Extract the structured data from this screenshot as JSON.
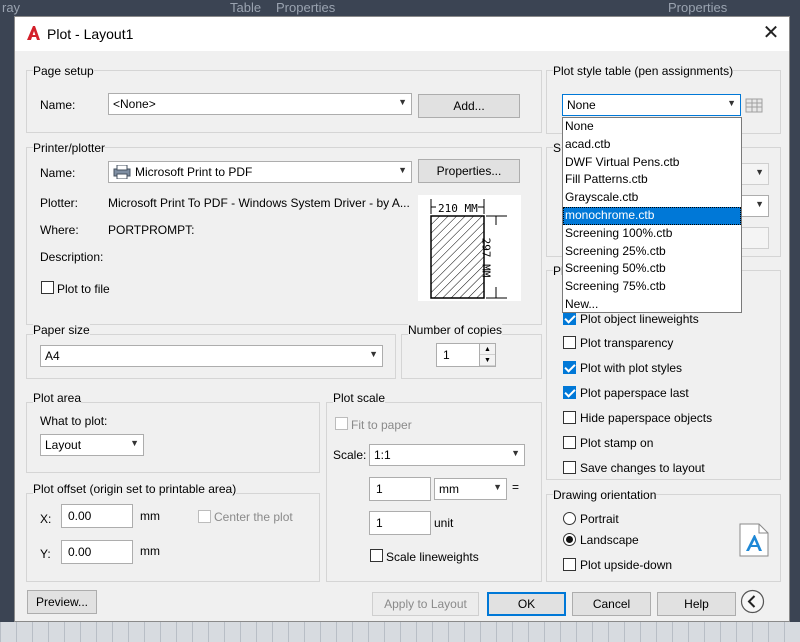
{
  "background": {
    "items": [
      "ray",
      "Table",
      "Properties",
      "Properties"
    ]
  },
  "dialog": {
    "title": "Plot - Layout1"
  },
  "page_setup": {
    "group_label": "Page setup",
    "name_label": "Name:",
    "name_value": "<None>",
    "add_label": "Add..."
  },
  "printer": {
    "group_label": "Printer/plotter",
    "name_label": "Name:",
    "name_value": "Microsoft Print to PDF",
    "properties_label": "Properties...",
    "plotter_label": "Plotter:",
    "plotter_value": "Microsoft Print To PDF - Windows System Driver - by A...",
    "where_label": "Where:",
    "where_value": "PORTPROMPT:",
    "description_label": "Description:",
    "plot_to_file_label": "Plot to file",
    "paper_width": "210 MM",
    "paper_height": "297 MM"
  },
  "paper_size": {
    "group_label": "Paper size",
    "value": "A4"
  },
  "copies": {
    "group_label": "Number of copies",
    "value": "1"
  },
  "plot_area": {
    "group_label": "Plot area",
    "what_label": "What to plot:",
    "value": "Layout"
  },
  "plot_offset": {
    "group_label": "Plot offset (origin set to printable area)",
    "x_label": "X:",
    "x_value": "0.00",
    "x_unit": "mm",
    "y_label": "Y:",
    "y_value": "0.00",
    "y_unit": "mm",
    "center_label": "Center the plot"
  },
  "plot_scale": {
    "group_label": "Plot scale",
    "fit_label": "Fit to paper",
    "scale_label": "Scale:",
    "scale_value": "1:1",
    "value1": "1",
    "unit_value": "mm",
    "equals": "=",
    "value2": "1",
    "unit2": "unit",
    "lineweights_label": "Scale lineweights"
  },
  "plot_style": {
    "group_label": "Plot style table (pen assignments)",
    "value": "None",
    "options": [
      "None",
      "acad.ctb",
      "DWF Virtual Pens.ctb",
      "Fill Patterns.ctb",
      "Grayscale.ctb",
      "monochrome.ctb",
      "Screening 100%.ctb",
      "Screening 25%.ctb",
      "Screening 50%.ctb",
      "Screening 75%.ctb",
      "New..."
    ],
    "selected_option": "monochrome.ctb",
    "shaded_label": "S",
    "plot_options_label": "Pl"
  },
  "plot_options": {
    "lineweights": "Plot object lineweights",
    "transparency": "Plot transparency",
    "styles": "Plot with plot styles",
    "paperspace_last": "Plot paperspace last",
    "hide_paperspace": "Hide paperspace objects",
    "stamp": "Plot stamp on",
    "save_changes": "Save changes to layout"
  },
  "orientation": {
    "group_label": "Drawing orientation",
    "portrait": "Portrait",
    "landscape": "Landscape",
    "upside_down": "Plot upside-down"
  },
  "footer": {
    "preview": "Preview...",
    "apply": "Apply to Layout",
    "ok": "OK",
    "cancel": "Cancel",
    "help": "Help"
  }
}
